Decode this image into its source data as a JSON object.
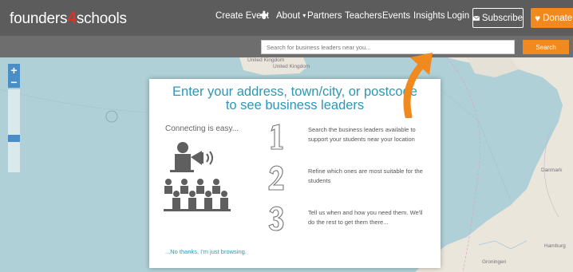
{
  "header": {
    "logo_pre": "founders",
    "logo_num": "4",
    "logo_post": "schools",
    "nav": {
      "create_event": "Create Event",
      "about": "About",
      "partners": "Partners",
      "teachers": "Teachers",
      "events": "Events",
      "insights": "Insights",
      "login": "Login"
    },
    "subscribe_label": "Subscribe",
    "donate_label": "Donate"
  },
  "search": {
    "placeholder": "Search for business leaders near you...",
    "button_label": "Search"
  },
  "map": {
    "labels": {
      "uk_1": "United Kingdom",
      "uk_2": "United Kingdom",
      "danmark": "Danmark",
      "hamburg": "Hamburg",
      "groningen": "Groningen"
    }
  },
  "modal": {
    "title_line1": "Enter your address, town/city, or postcode",
    "title_line2": "to see business leaders",
    "connecting": "Connecting is easy...",
    "steps": [
      {
        "num": "1",
        "text": "Search the business leaders available to support your students near your location"
      },
      {
        "num": "2",
        "text": "Refine which ones are most suitable for the students"
      },
      {
        "num": "3",
        "text": "Tell us when and how you need them. We'll do the rest to get them there..."
      }
    ],
    "browse_link": "...No thanks, I'm just browsing."
  },
  "colors": {
    "brand_orange": "#f18a1e",
    "brand_red": "#e0322b",
    "accent_blue": "#2b97b8",
    "header_bg": "#5c5c5c"
  }
}
